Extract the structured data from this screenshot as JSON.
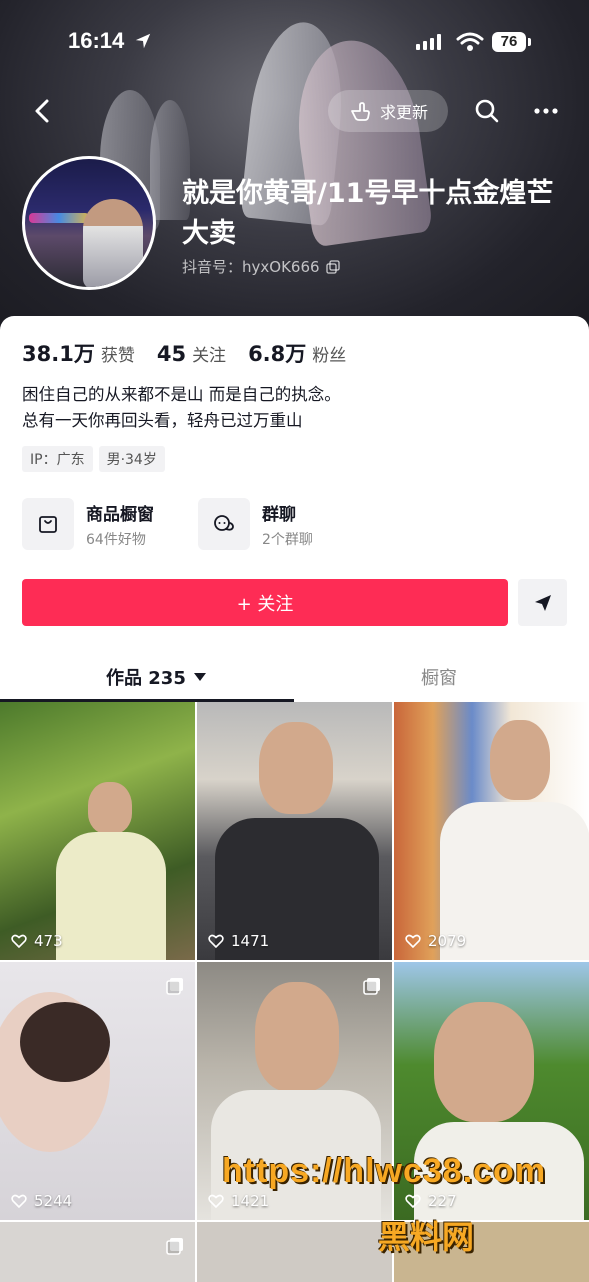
{
  "status_bar": {
    "time": "16:14",
    "battery": "76"
  },
  "header": {
    "request_update_label": "求更新"
  },
  "profile": {
    "name": "就是你黄哥/11号早十点金煌芒大卖",
    "douyin_id": "抖音号：hyxOK666"
  },
  "stats": [
    {
      "value": "38.1万",
      "label": "获赞"
    },
    {
      "value": "45",
      "label": "关注"
    },
    {
      "value": "6.8万",
      "label": "粉丝"
    }
  ],
  "bio": {
    "line1": "困住自己的从来都不是山 而是自己的执念。",
    "line2": "总有一天你再回头看，轻舟已过万重山"
  },
  "tags": [
    "IP：广东",
    "男·34岁"
  ],
  "services": [
    {
      "title": "商品橱窗",
      "subtitle": "64件好物"
    },
    {
      "title": "群聊",
      "subtitle": "2个群聊"
    }
  ],
  "follow_button": "+ 关注",
  "tabs": {
    "works": "作品 235",
    "window": "橱窗"
  },
  "videos": [
    {
      "likes": "473"
    },
    {
      "likes": "1471"
    },
    {
      "likes": "2079"
    },
    {
      "likes": "5244"
    },
    {
      "likes": "1421"
    },
    {
      "likes": "227"
    }
  ],
  "watermark": {
    "url": "https://hlwc38.com",
    "name": "黑料网"
  }
}
